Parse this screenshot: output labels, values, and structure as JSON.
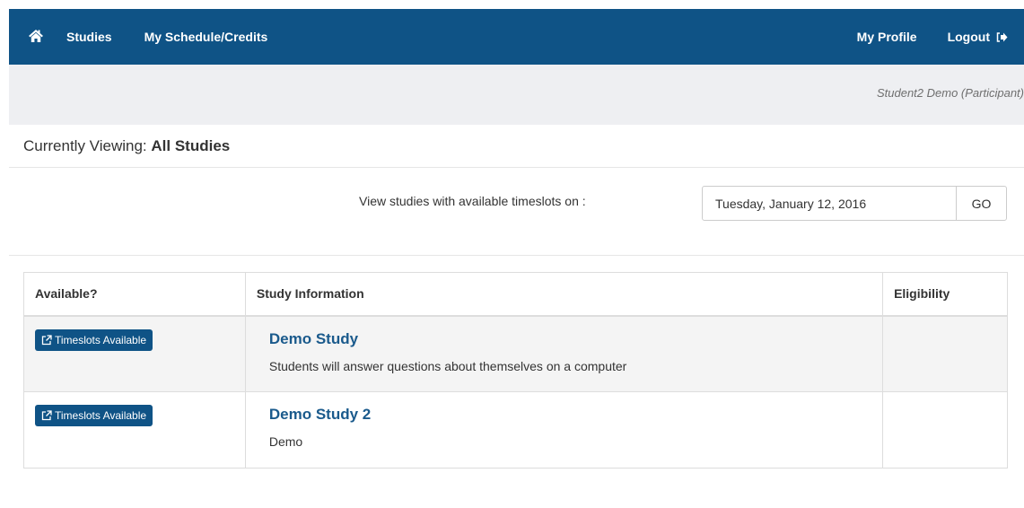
{
  "nav": {
    "home_icon": "home-icon",
    "studies": "Studies",
    "schedule": "My Schedule/Credits",
    "profile": "My Profile",
    "logout": "Logout",
    "logout_icon": "logout-icon",
    "bar_color": "#0f5386"
  },
  "user": {
    "name": "Student2 Demo (Participant)"
  },
  "viewing": {
    "label": "Currently Viewing:",
    "value": "All Studies"
  },
  "filter": {
    "label": "View studies with available timeslots on :",
    "date": "Tuesday, January 12, 2016",
    "go_label": "GO"
  },
  "table": {
    "headers": [
      "Available?",
      "Study Information",
      "Eligibility"
    ],
    "rows": [
      {
        "available": "Timeslots Available",
        "title": "Demo Study",
        "description": "Students will answer questions about themselves on a computer",
        "eligibility": ""
      },
      {
        "available": "Timeslots Available",
        "title": "Demo Study 2",
        "description": "Demo",
        "eligibility": ""
      }
    ]
  }
}
